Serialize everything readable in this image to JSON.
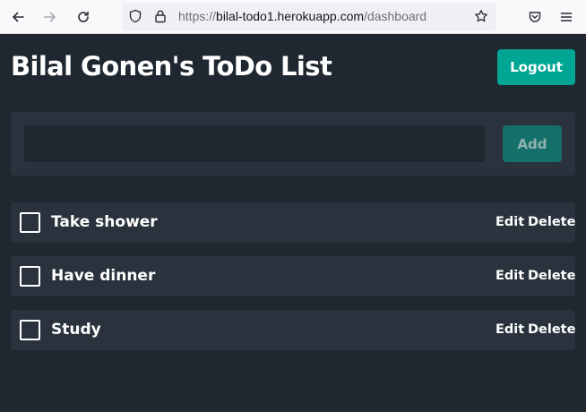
{
  "browser": {
    "url_prefix": "https://",
    "url_host": "bilal-todo1.herokuapp.com",
    "url_path": "/dashboard"
  },
  "app": {
    "title": "Bilal Gonen's ToDo List",
    "logout_label": "Logout"
  },
  "add_form": {
    "input_value": "",
    "input_placeholder": "",
    "add_label": "Add"
  },
  "todos": [
    {
      "label": "Take shower",
      "edit_label": "Edit",
      "delete_label": "Delete",
      "checked": false
    },
    {
      "label": "Have dinner",
      "edit_label": "Edit",
      "delete_label": "Delete",
      "checked": false
    },
    {
      "label": "Study",
      "edit_label": "Edit",
      "delete_label": "Delete",
      "checked": false
    }
  ],
  "colors": {
    "background": "#1f2730",
    "panel": "#2a333d",
    "accent": "#00a693",
    "add_button": "#16706a"
  }
}
